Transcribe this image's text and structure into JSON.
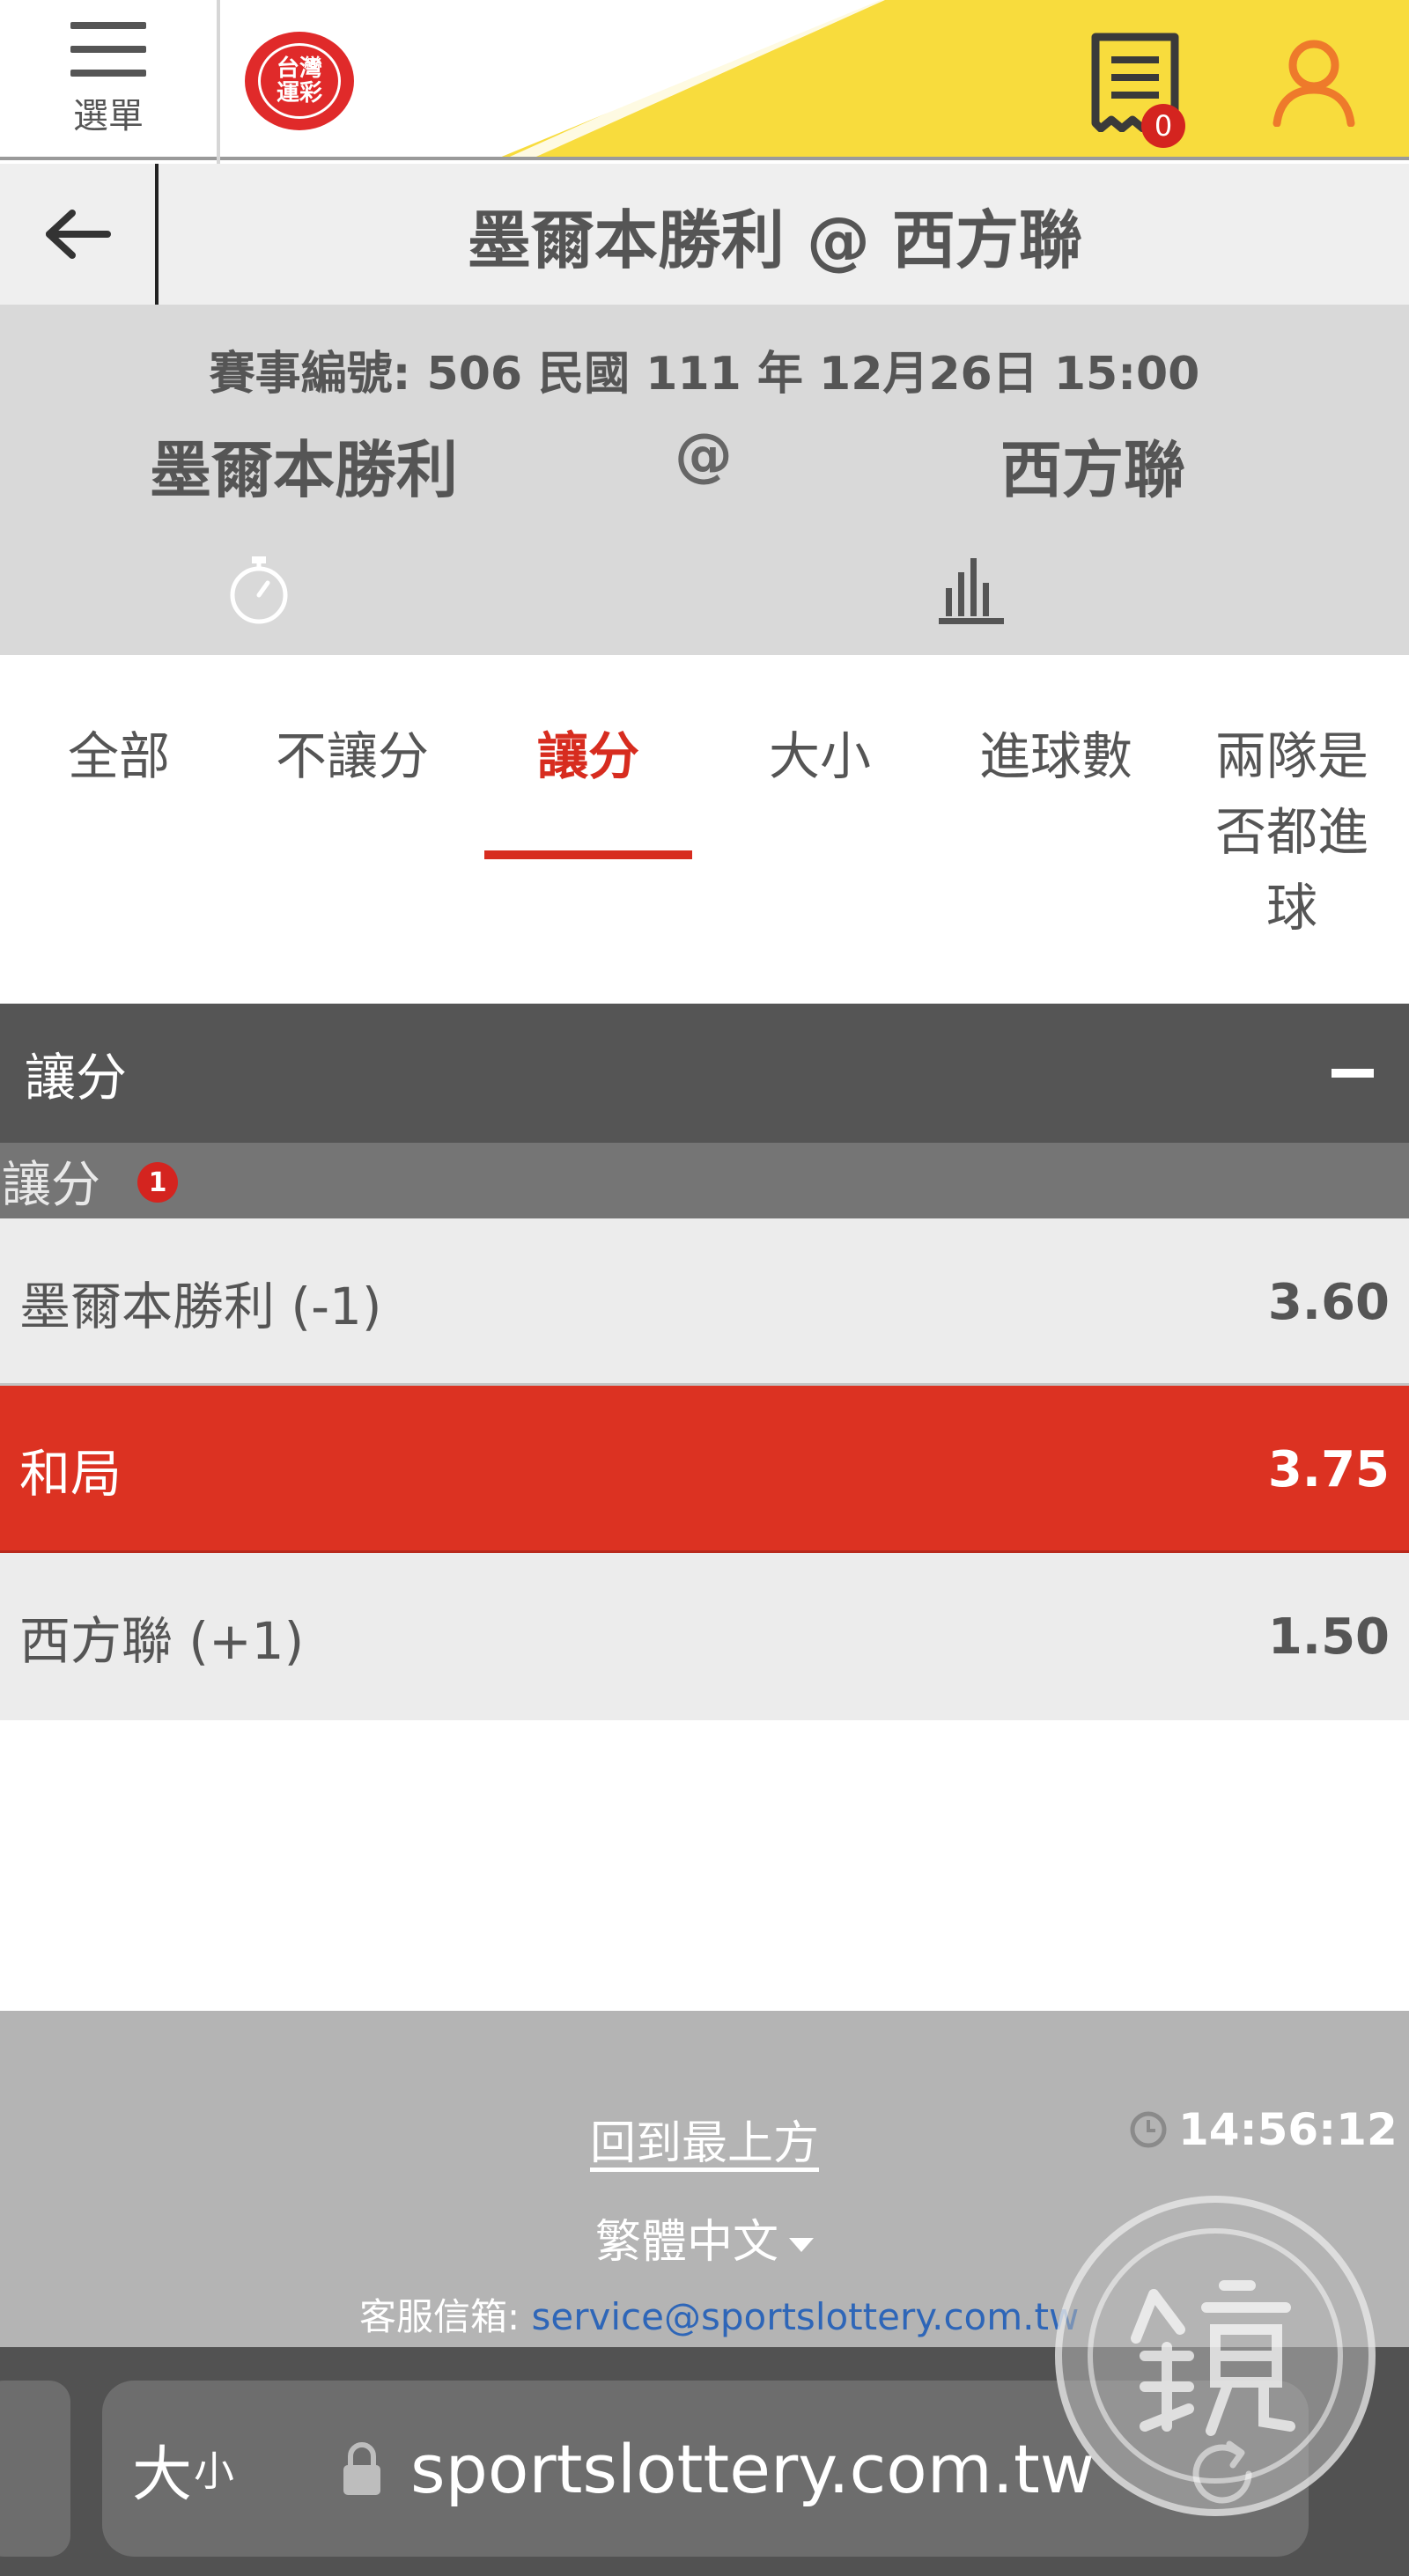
{
  "header": {
    "menu_label": "選單",
    "logo_line1": "台灣",
    "logo_line2": "運彩",
    "bet_slip_count": "0",
    "accent_color": "#f8dc3d"
  },
  "titlebar": {
    "back_icon": "arrow-left-icon",
    "title": "墨爾本勝利 @ 西方聯"
  },
  "match": {
    "meta": "賽事編號: 506 民國 111 年 12月26日 15:00",
    "home": "墨爾本勝利",
    "at": "@",
    "away": "西方聯",
    "icons": [
      "stopwatch-icon",
      "bar-chart-icon"
    ]
  },
  "tabs": [
    {
      "label": "全部",
      "active": false
    },
    {
      "label": "不讓分",
      "active": false
    },
    {
      "label": "讓分",
      "active": true
    },
    {
      "label": "大小",
      "active": false
    },
    {
      "label": "進球數",
      "active": false
    },
    {
      "label": "兩隊是\n否都進\n球",
      "active": false
    }
  ],
  "market": {
    "section_title": "讓分",
    "collapse_icon": "minus-icon",
    "sub_title": "讓分",
    "sub_count": "1",
    "selected_color": "#dc3222",
    "rows": [
      {
        "name": "墨爾本勝利 (-1)",
        "price": "3.60",
        "selected": false
      },
      {
        "name": "和局",
        "price": "3.75",
        "selected": true
      },
      {
        "name": "西方聯 (+1)",
        "price": "1.50",
        "selected": false
      }
    ]
  },
  "footer": {
    "back_to_top": "回到最上方",
    "time": "14:56:12",
    "language": "繁體中文",
    "service_label": "客服信箱: ",
    "service_email": "service@sportslottery.com.tw"
  },
  "browser": {
    "text_size_big": "大",
    "text_size_small": "小",
    "url": "sportslottery.com.tw"
  }
}
